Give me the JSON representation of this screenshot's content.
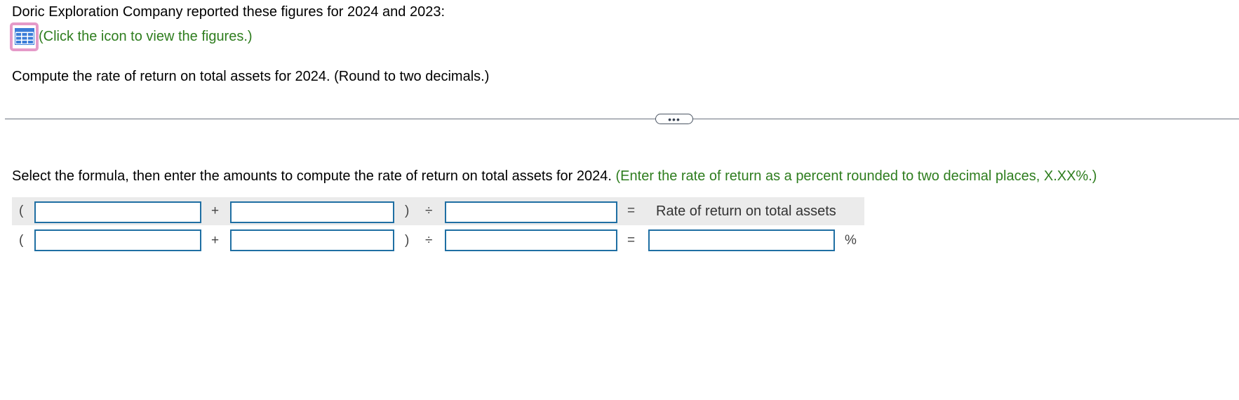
{
  "intro": "Doric Exploration Company reported these figures for 2024 and 2023:",
  "figures_hint": "(Click the icon to view the figures.)",
  "question": "Compute the rate of return on total assets for 2024. (Round to two decimals.)",
  "expand_label": "•••",
  "instruction": {
    "main": "Select the formula, then enter the amounts to compute the rate of return on total assets for 2024.",
    "hint": "(Enter the rate of return as a percent rounded to two decimal places, X.XX%.)"
  },
  "formula": {
    "open_paren": "(",
    "plus": "+",
    "close_paren": ")",
    "divide": "÷",
    "equals": "=",
    "result_label": "Rate of return on total assets",
    "percent": "%",
    "row1": {
      "input1": "",
      "input2": "",
      "input3": ""
    },
    "row2": {
      "input1": "",
      "input2": "",
      "input3": "",
      "result": ""
    }
  },
  "colors": {
    "hint_green": "#2e7d1e",
    "input_border": "#1f6fa3",
    "icon_highlight": "#e59ac8",
    "icon_blue": "#3b7dd8"
  },
  "icons": {
    "figures": "table-grid-icon"
  }
}
